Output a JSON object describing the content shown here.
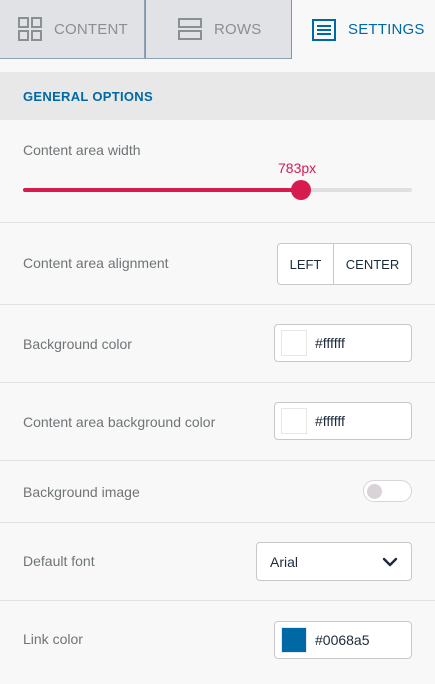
{
  "tabs": [
    {
      "label": "CONTENT",
      "icon": "grid-icon"
    },
    {
      "label": "ROWS",
      "icon": "rows-icon"
    },
    {
      "label": "SETTINGS",
      "icon": "settings-list-icon",
      "active": true
    }
  ],
  "section": {
    "title": "GENERAL OPTIONS"
  },
  "content_width": {
    "label": "Content area width",
    "value_text": "783px",
    "fraction": 0.715
  },
  "alignment": {
    "label": "Content area alignment",
    "left": "LEFT",
    "center": "CENTER"
  },
  "background_color": {
    "label": "Background color",
    "value": "#ffffff",
    "swatch": "#ffffff"
  },
  "content_bg_color": {
    "label": "Content area background color",
    "value": "#ffffff",
    "swatch": "#ffffff"
  },
  "background_image": {
    "label": "Background image",
    "enabled": false
  },
  "default_font": {
    "label": "Default font",
    "value": "Arial"
  },
  "link_color": {
    "label": "Link color",
    "value": "#0068a5",
    "swatch": "#0068a5"
  },
  "colors": {
    "accent": "#0068a5",
    "slider": "#d71b4f"
  }
}
